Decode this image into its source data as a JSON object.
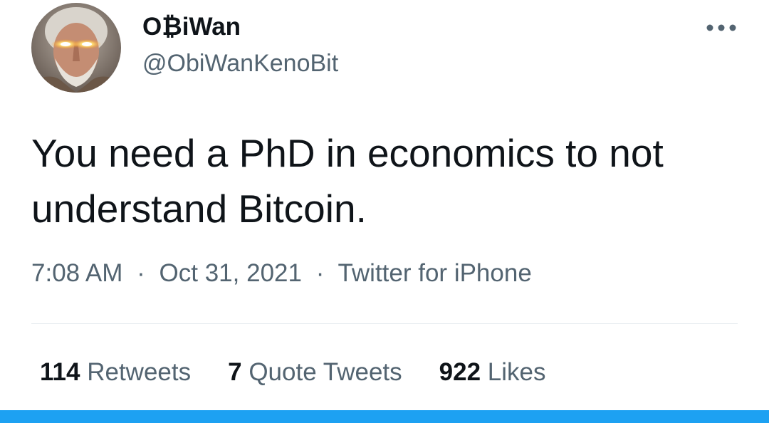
{
  "author": {
    "display_name": "O₿iWan",
    "handle": "@ObiWanKenoBit",
    "avatar_icon": "avatar-old-man-glowing-eyes"
  },
  "tweet": {
    "text": "You need a PhD in economics to not understand Bitcoin.",
    "time": "7:08 AM",
    "date": "Oct 31, 2021",
    "source": "Twitter for iPhone",
    "separator": "·"
  },
  "stats": {
    "retweets_count": "114",
    "retweets_label": "Retweets",
    "quote_tweets_count": "7",
    "quote_tweets_label": "Quote Tweets",
    "likes_count": "922",
    "likes_label": "Likes"
  },
  "colors": {
    "text_primary": "#0f1419",
    "text_secondary": "#536471",
    "accent_blue": "#1da1f2",
    "divider": "#e6ecf0"
  },
  "icons": {
    "more": "more-horizontal-icon"
  }
}
